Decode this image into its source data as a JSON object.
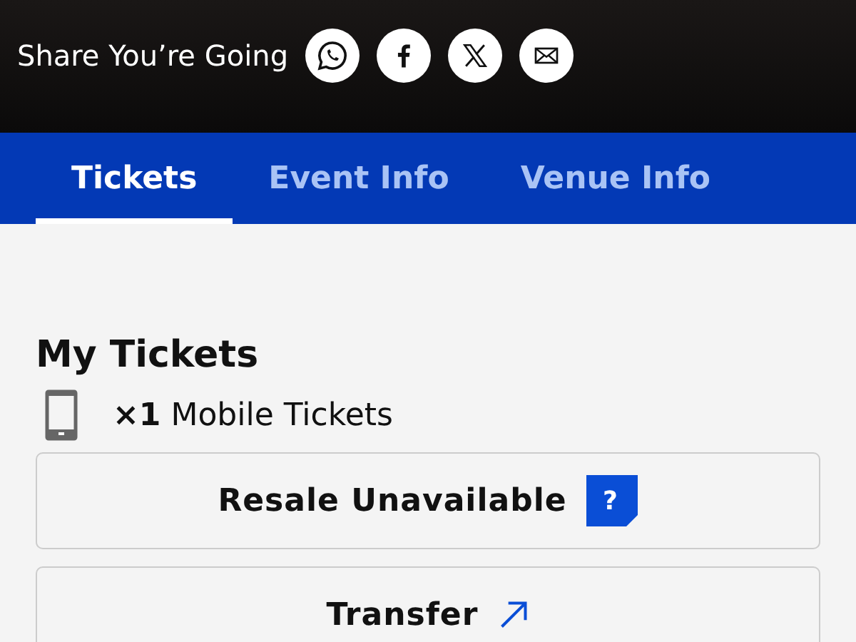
{
  "share": {
    "label": "Share You’re Going",
    "buttons": [
      {
        "kind": "whatsapp"
      },
      {
        "kind": "facebook"
      },
      {
        "kind": "x"
      },
      {
        "kind": "email"
      }
    ]
  },
  "tabs": [
    {
      "label": "Tickets",
      "selected": true
    },
    {
      "label": "Event Info",
      "selected": false
    },
    {
      "label": "Venue Info",
      "selected": false
    }
  ],
  "my_tickets": {
    "title": "My Tickets",
    "count": "**×1** Mobile Tickets",
    "actions": [
      {
        "label": "Resale Unavailable",
        "kind": "help",
        "icon": "?"
      },
      {
        "label": "Transfer",
        "kind": "external"
      }
    ]
  }
}
